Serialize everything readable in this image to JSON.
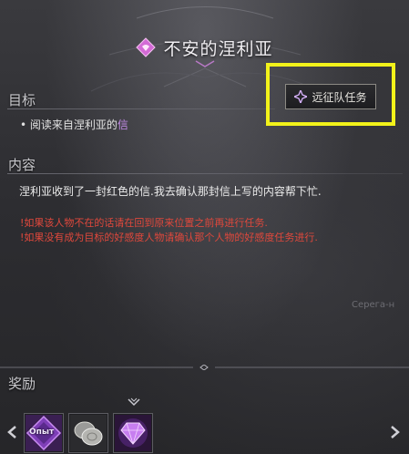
{
  "quest": {
    "title": "不安的涅利亚"
  },
  "objective": {
    "section_label": "目标",
    "bullet": "•",
    "text_prefix": "阅读来自涅利亚的",
    "text_accent": "信"
  },
  "expedition_button": {
    "label": "远征队任务"
  },
  "content": {
    "section_label": "内容",
    "text": "涅利亚收到了一封红色的信.我去确认那封信上写的内容帮下忙.",
    "warning_1": "!如果该人物不在的话请在回到原来位置之前再进行任务.",
    "warning_2": "!如果没有成为目标的好感度人物请确认那个人物的好感度任务进行.",
    "background_text": "Серега-н"
  },
  "rewards": {
    "section_label": "奖励",
    "items": [
      {
        "icon": "exp-scroll-icon",
        "label": "Опыт"
      },
      {
        "icon": "silver-coins-icon"
      },
      {
        "icon": "purple-gem-icon"
      }
    ]
  },
  "colors": {
    "accent_purple": "#c28be6",
    "warning_red": "#e0483c",
    "highlight_yellow": "#f2f21a"
  }
}
